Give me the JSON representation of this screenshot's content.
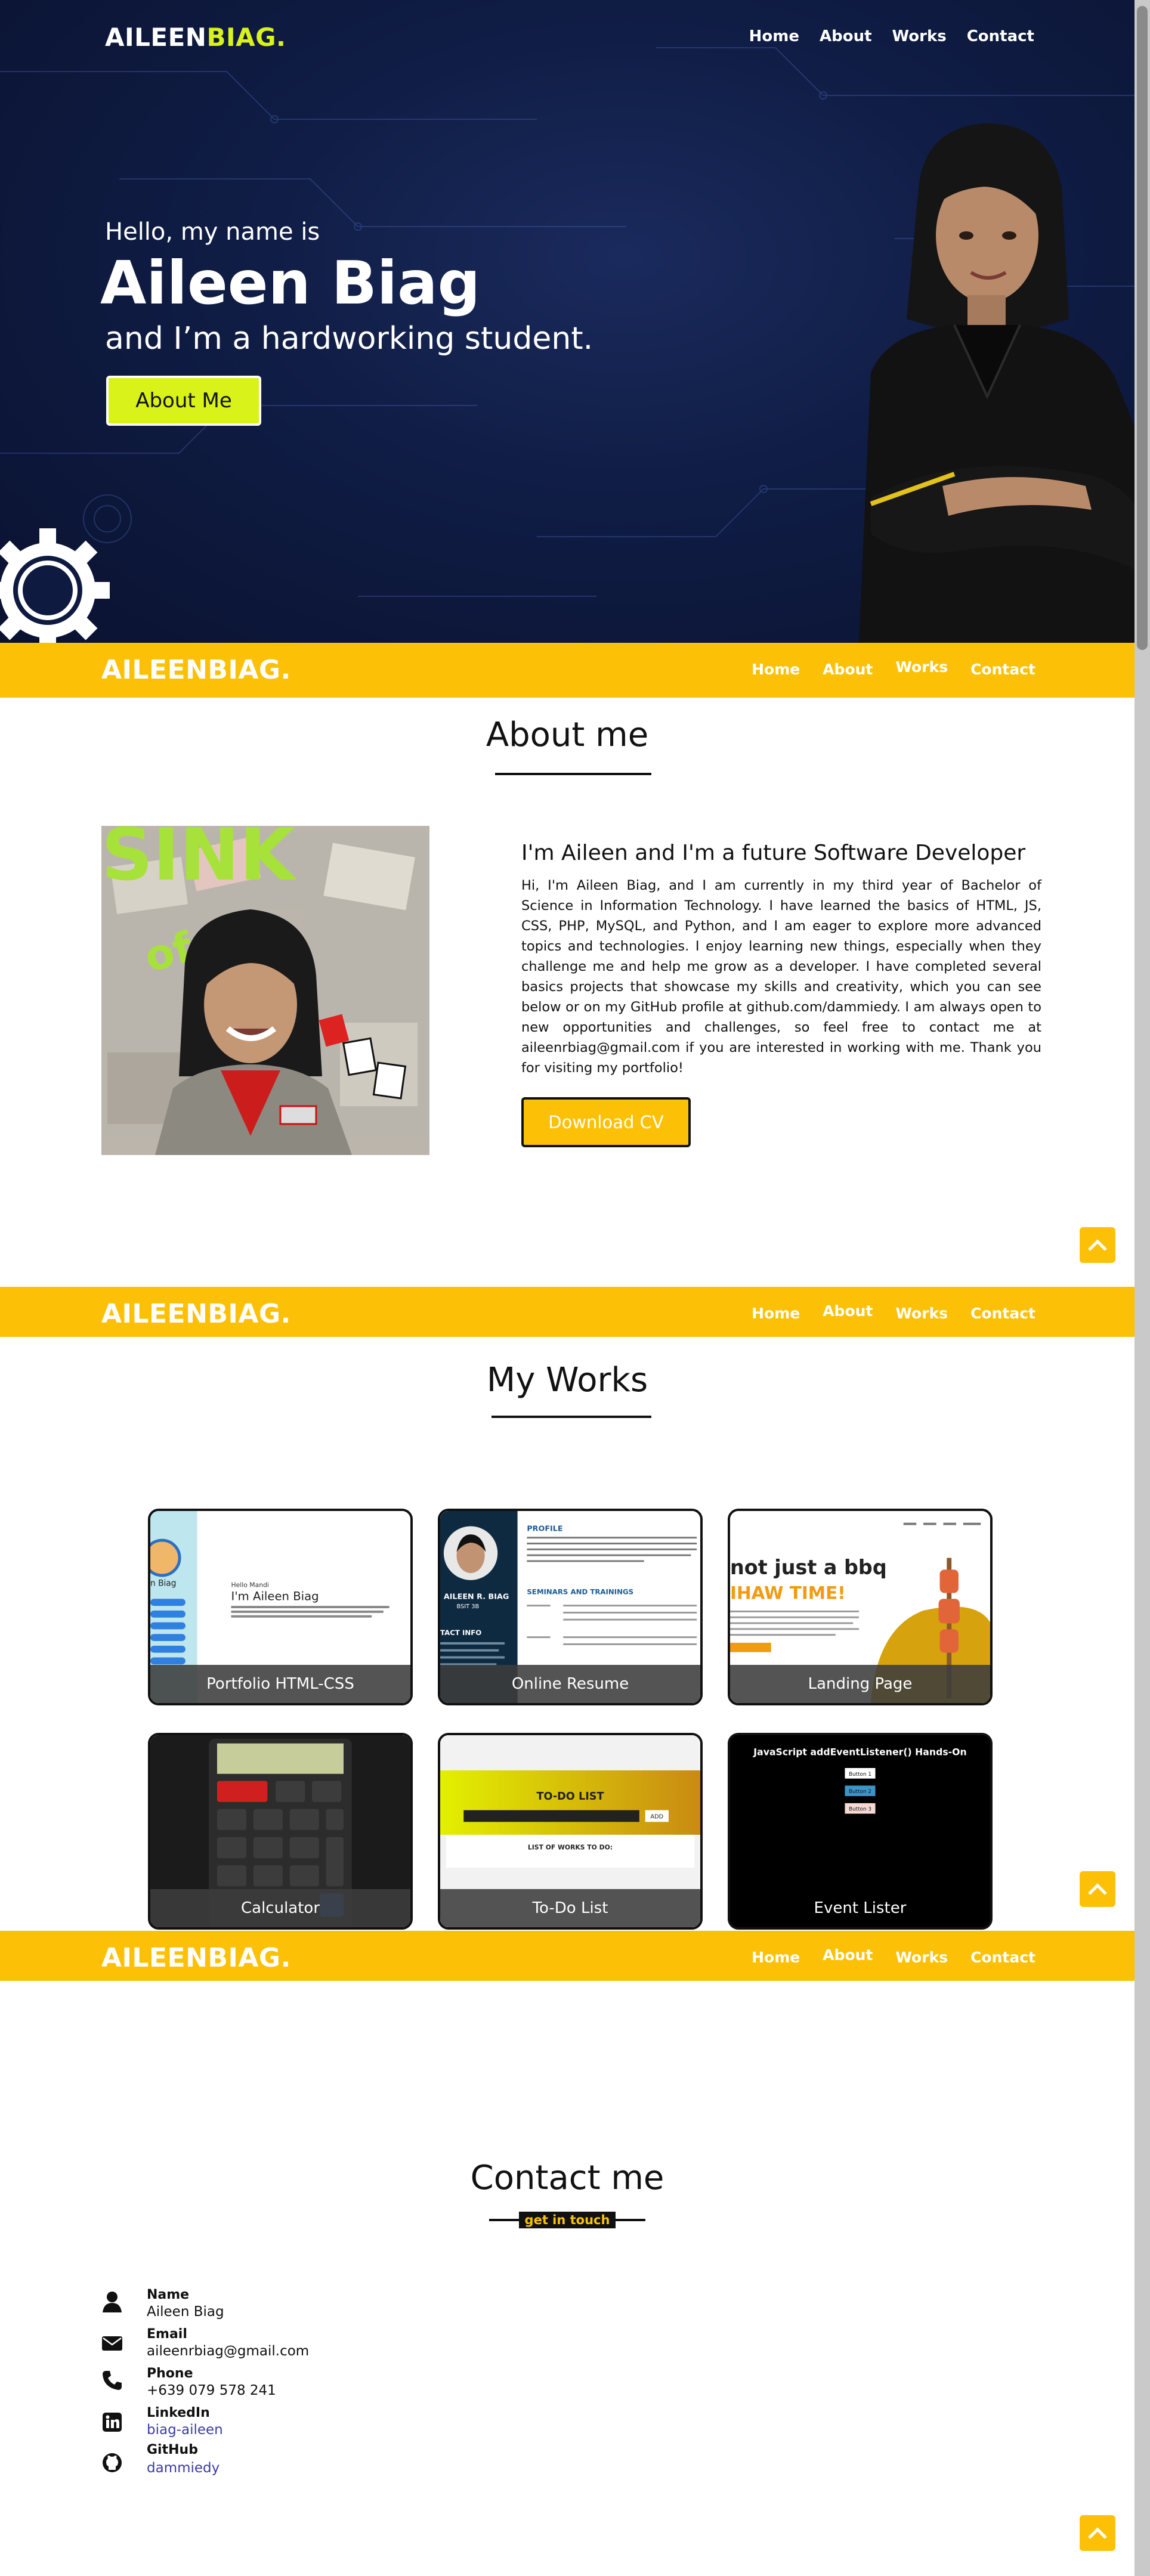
{
  "brand": {
    "part1": "AILEEN",
    "part2": "BIAG."
  },
  "brand_full": "AILEENBIAG.",
  "nav": [
    "Home",
    "About",
    "Works",
    "Contact"
  ],
  "hero": {
    "greeting": "Hello, my name is",
    "name": "Aileen Biag",
    "tagline": "and I’m a hardworking student.",
    "cta": "About Me"
  },
  "about": {
    "title": "About me",
    "heading": "I'm Aileen and I'm a future Software Developer",
    "body": "Hi, I'm Aileen Biag, and I am currently in my third year of Bachelor of Science in Information Technology. I have learned the basics of HTML, JS, CSS, PHP, MySQL, and Python, and I am eager to explore more advanced topics and technologies. I enjoy learning new things, especially when they challenge me and help me grow as a developer. I have completed several basics projects that showcase my skills and creativity, which you can see below or on my GitHub profile at github.com/dammiedy. I am always open to new opportunities and challenges, so feel free to contact me at aileenrbiag@gmail.com if you are interested in working with me. Thank you for visiting my portfolio!",
    "cv_button": "Download CV"
  },
  "works": {
    "title": "My Works",
    "items": [
      {
        "label": "Portfolio HTML-CSS"
      },
      {
        "label": "Online Resume"
      },
      {
        "label": "Landing Page"
      },
      {
        "label": "Calculator"
      },
      {
        "label": "To-Do List"
      },
      {
        "label": "Event Lister"
      }
    ],
    "thumb_text": {
      "portfolio_hello": "Hello Mandi",
      "portfolio_name": "I'm Aileen Biag",
      "portfolio_side": "n Biag",
      "resume_name": "AILEEN R. BIAG",
      "resume_role": "BSIT 3B",
      "resume_profile": "PROFILE",
      "resume_seminars": "SEMINARS AND TRAININGS",
      "resume_contact": "TACT INFO",
      "landing_line1": "not just a bbq",
      "landing_line2": "IHAW TIME!",
      "todo_title": "TO-DO LIST",
      "todo_add": "ADD",
      "todo_list": "LIST OF WORKS TO DO:",
      "event_title": "JavaScript addEventListener() Hands-On",
      "event_btn1": "Button 1",
      "event_btn2": "Button 2",
      "event_btn3": "Button 3"
    }
  },
  "contact": {
    "title": "Contact me",
    "subtitle": "get in touch",
    "items": [
      {
        "label": "Name",
        "value": "Aileen Biag",
        "icon": "user-icon"
      },
      {
        "label": "Email",
        "value": "aileenrbiag@gmail.com",
        "icon": "envelope-icon"
      },
      {
        "label": "Phone",
        "value": "+639 079 578 241",
        "icon": "phone-icon"
      },
      {
        "label": "LinkedIn",
        "value": "biag-aileen",
        "icon": "linkedin-icon"
      },
      {
        "label": "GitHub",
        "value": "dammiedy",
        "icon": "github-icon"
      }
    ]
  },
  "colors": {
    "accent_yellow": "#fcc107",
    "lime": "#d9f21a",
    "hero_navy": "#0f1c44"
  }
}
